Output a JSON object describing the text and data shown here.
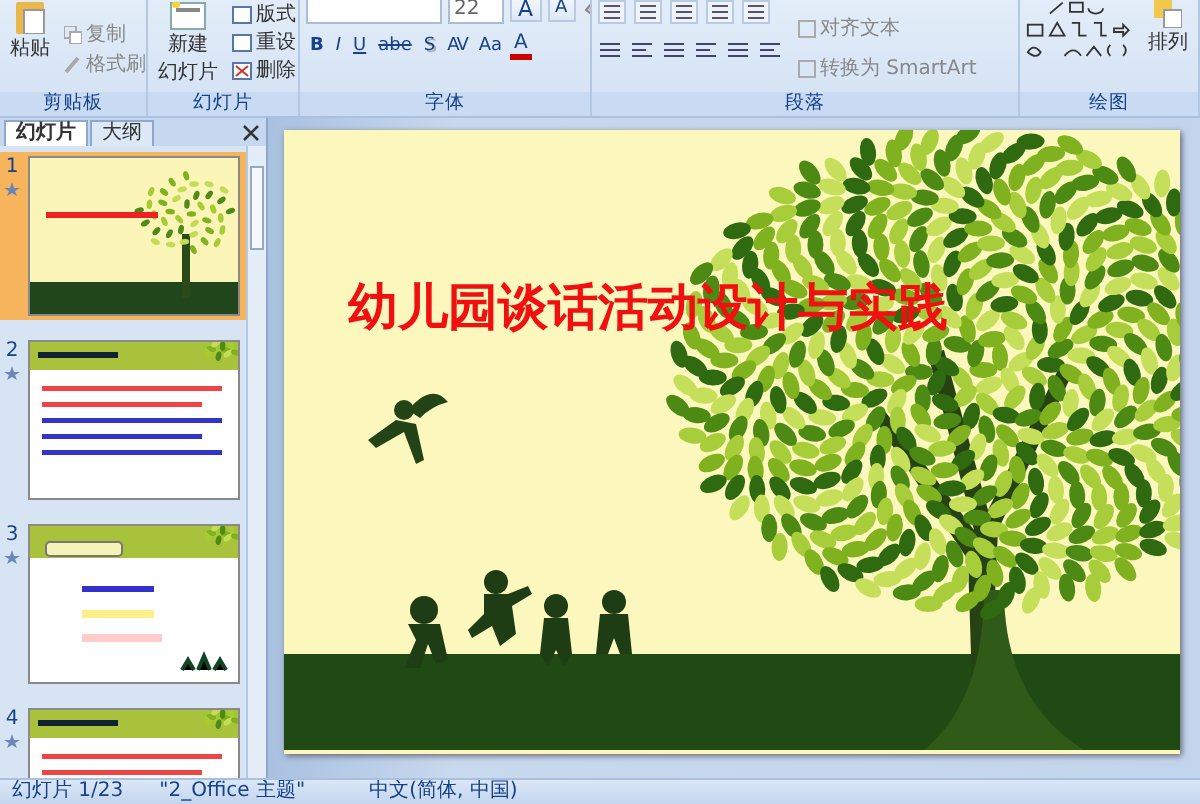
{
  "ribbon": {
    "clipboard": {
      "paste": "粘贴",
      "small_buttons": [
        "复制",
        "格式刷"
      ],
      "label": "剪贴板"
    },
    "slides": {
      "new_slide": [
        "新建",
        "幻灯片"
      ],
      "small_buttons": [
        "版式",
        "重设",
        "删除"
      ],
      "label": "幻灯片"
    },
    "font": {
      "font_size": "22",
      "grow_buttons": [
        "A",
        "A"
      ],
      "format_buttons": [
        "B",
        "I",
        "U",
        "abe",
        "S",
        "AV",
        "Aa"
      ],
      "color_button": "A",
      "label": "字体"
    },
    "paragraph": {
      "text_buttons": [
        "对齐文本",
        "转换为 SmartArt"
      ],
      "label": "段落"
    },
    "drawing": {
      "arrange": "排列",
      "label": "绘图"
    }
  },
  "panel": {
    "tabs": [
      {
        "label": "幻灯片",
        "selected": true
      },
      {
        "label": "大纲",
        "selected": false
      }
    ],
    "thumbnails": [
      {
        "number": "1",
        "selected": true,
        "kind": "title"
      },
      {
        "number": "2",
        "selected": false,
        "kind": "text"
      },
      {
        "number": "3",
        "selected": false,
        "kind": "list"
      },
      {
        "number": "4",
        "selected": false,
        "kind": "text"
      }
    ]
  },
  "slide": {
    "title": "幼儿园谈话活动设计与实践"
  },
  "status_bar": {
    "slide_count": "幻灯片 1/23",
    "theme": "\"2_Office 主题\"",
    "language": "中文(简体, 中国)"
  }
}
